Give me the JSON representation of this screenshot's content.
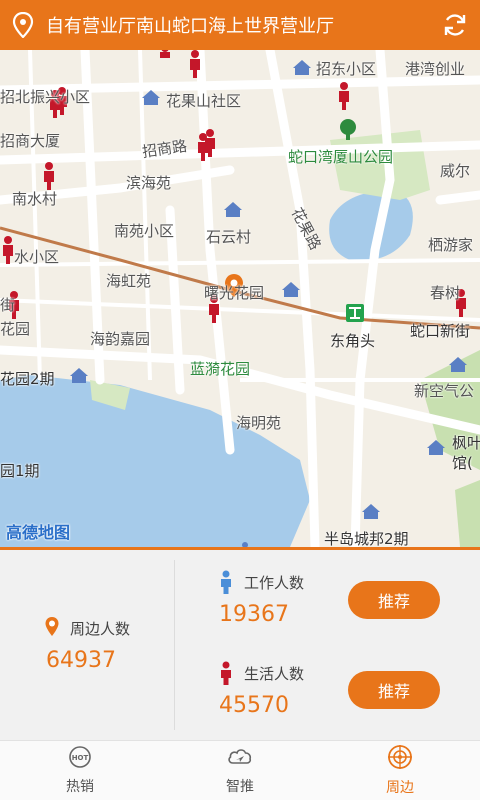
{
  "header": {
    "title": "自有营业厅南山蛇口海上世界营业厅",
    "location_icon": "location-pin-icon",
    "refresh_icon": "refresh-icon"
  },
  "map": {
    "provider_label": "高德地图",
    "labels": {
      "zhaodong": "招东小区",
      "ganwan": "港湾创业",
      "zhaobeishen": "招北振兴小区",
      "huaguoshan": "花果山社区",
      "zhaoshangdasha": "招商大厦",
      "zhaoshanglu": "招商路",
      "shekouwan": "蛇口湾厦山公园",
      "weier": "威尔",
      "nanshuicun": "南水村",
      "binhaiyuan": "滨海苑",
      "huaguolu": "花果路",
      "nanyuan": "南苑小区",
      "shiyuncun": "石云村",
      "shuixiaoqu": "水小区",
      "qiyoujia": "栖游家",
      "haihongyuan": "海虹苑",
      "shuguanghuayuan": "曙光花园",
      "chunshu": "春树",
      "jie": "街",
      "dongjiaotou": "东角头",
      "shekouxinjie": "蛇口新街",
      "huayuan": "花园",
      "haiyunjiayuan": "海韵嘉园",
      "lanqihuayuan": "蓝漪花园",
      "huayuan2": "花园2期",
      "xinkongqi": "新空气公",
      "haimingyuan": "海明苑",
      "fengye": "枫叶",
      "guan": "馆(",
      "yuan1": "园1期",
      "bandao": "半岛城邦2期"
    },
    "colors": {
      "water": "#a6cbea",
      "road": "#ffffff",
      "park": "#c8e0b0",
      "rail": "#c07a4a"
    }
  },
  "stats": {
    "nearby": {
      "label": "周边人数",
      "value": "64937",
      "icon": "nearby-pin-icon"
    },
    "work": {
      "label": "工作人数",
      "value": "19367",
      "icon": "worker-person-icon",
      "button": "推荐"
    },
    "live": {
      "label": "生活人数",
      "value": "45570",
      "icon": "resident-person-icon",
      "button": "推荐"
    }
  },
  "tabs": [
    {
      "label": "热销",
      "icon": "hot-icon",
      "active": false
    },
    {
      "label": "智推",
      "icon": "smart-push-icon",
      "active": false
    },
    {
      "label": "周边",
      "icon": "nearby-target-icon",
      "active": true
    }
  ],
  "accent": "#e8751a"
}
